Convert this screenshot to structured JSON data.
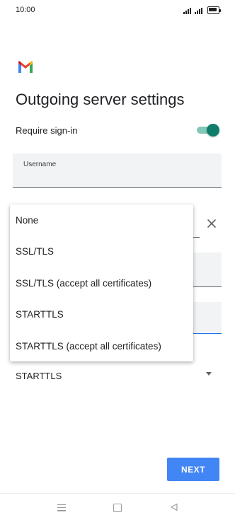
{
  "status_bar": {
    "time": "10:00",
    "icons": [
      "signal-icon",
      "signal-icon",
      "battery-icon"
    ]
  },
  "app": {
    "logo": "gmail-logo",
    "title": "Outgoing server settings"
  },
  "form": {
    "require_signin_label": "Require sign-in",
    "require_signin_on": true,
    "username_label": "Username",
    "security_type_value": "STARTTLS"
  },
  "dropdown_menu": {
    "options": [
      "None",
      "SSL/TLS",
      "SSL/TLS (accept all certificates)",
      "STARTTLS",
      "STARTTLS (accept all certificates)"
    ]
  },
  "buttons": {
    "next_label": "NEXT"
  },
  "colors": {
    "accent_teal": "#0f7d6b",
    "button_blue": "#4285f4",
    "focus_blue": "#1a73e8"
  },
  "nav_bar": {
    "icons": [
      "menu-icon",
      "home-icon",
      "back-icon"
    ]
  }
}
